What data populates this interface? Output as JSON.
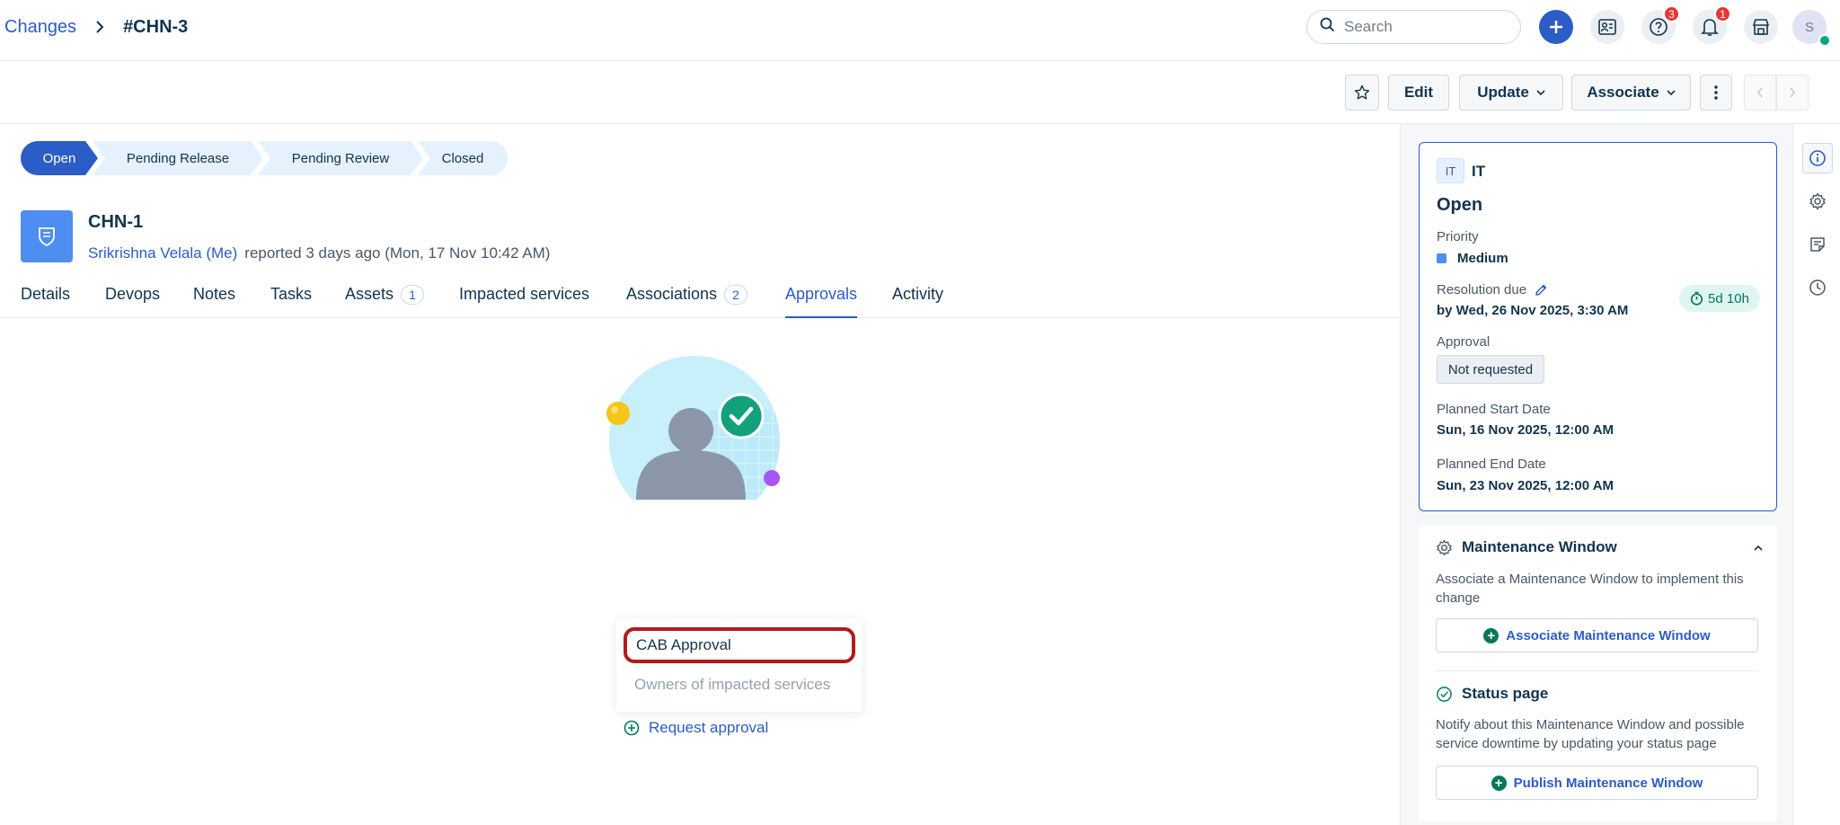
{
  "header": {
    "breadcrumb_root": "Changes",
    "breadcrumb_current": "#CHN-3",
    "search_placeholder": "Search",
    "help_badge": "3",
    "notif_badge": "1",
    "avatar_initial": "S",
    "icons": [
      "search-icon",
      "plus-icon",
      "admin-icon",
      "help-icon",
      "bell-icon",
      "apps-icon"
    ]
  },
  "actions": {
    "edit": "Edit",
    "update": "Update",
    "associate": "Associate"
  },
  "workflow": {
    "steps": [
      "Open",
      "Pending Release",
      "Pending Review",
      "Closed"
    ],
    "current": "Open"
  },
  "ticket": {
    "title": "CHN-1",
    "reporter": "Srikrishna Velala (Me)",
    "reported": "reported 3 days ago (Mon, 17 Nov 10:42 AM)"
  },
  "tabs": [
    {
      "label": "Details"
    },
    {
      "label": "Devops"
    },
    {
      "label": "Notes"
    },
    {
      "label": "Tasks"
    },
    {
      "label": "Assets",
      "count": "1"
    },
    {
      "label": "Impacted services"
    },
    {
      "label": "Associations",
      "count": "2"
    },
    {
      "label": "Approvals",
      "active": true
    },
    {
      "label": "Activity"
    }
  ],
  "approval": {
    "name": "CAB Approval",
    "owners": "Owners of impacted services",
    "request": "Request approval"
  },
  "details": {
    "workspace_chip": "IT",
    "workspace": "IT",
    "status": "Open",
    "priority_label": "Priority",
    "priority": "Medium",
    "resolution_label": "Resolution due",
    "resolution": "by Wed, 26 Nov 2025, 3:30 AM",
    "sla": "5d 10h",
    "approval_label": "Approval",
    "approval": "Not requested",
    "start_label": "Planned Start Date",
    "start": "Sun, 16 Nov 2025, 12:00 AM",
    "end_label": "Planned End Date",
    "end": "Sun, 23 Nov 2025, 12:00 AM"
  },
  "maintenance": {
    "title": "Maintenance Window",
    "text": "Associate a Maintenance Window to implement this change",
    "button": "Associate Maintenance Window"
  },
  "status_page": {
    "title": "Status page",
    "text": "Notify about this Maintenance Window and possible service downtime by updating your status page",
    "button": "Publish Maintenance Window"
  },
  "colors": {
    "primary": "#2c5cc5",
    "text": "#12344d",
    "highlight": "#b21b1b",
    "success": "#00795b"
  }
}
